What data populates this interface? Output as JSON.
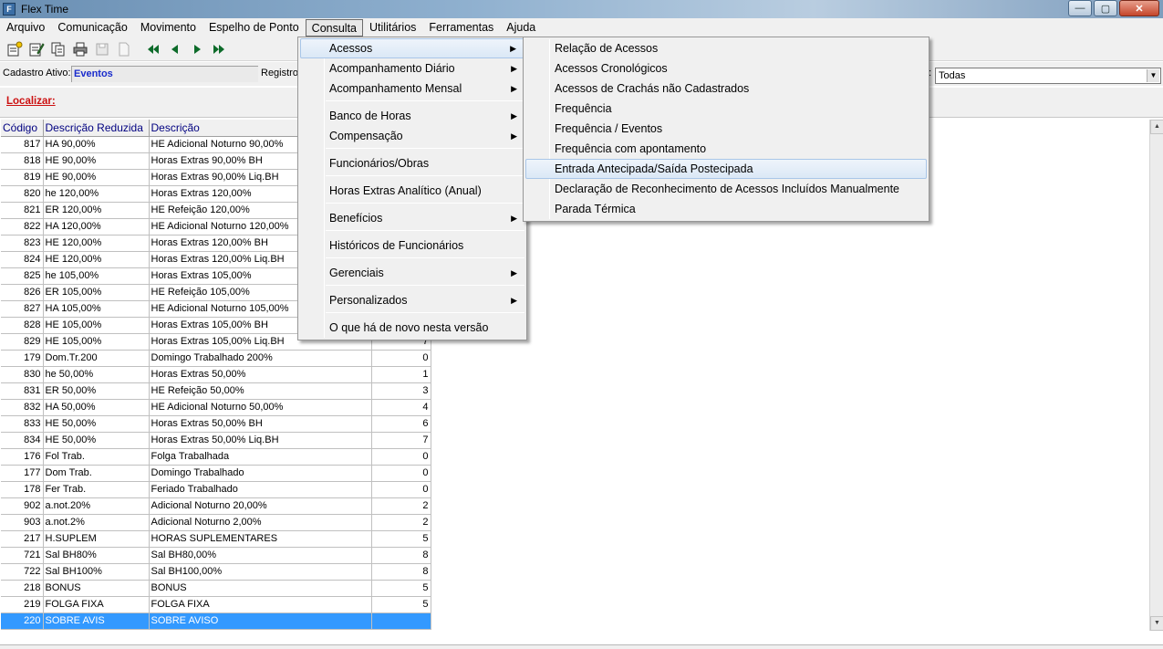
{
  "window": {
    "title": "Flex Time",
    "icon_letter": "F",
    "btn_minimize": "—",
    "btn_maximize": "▢",
    "btn_close": "✕"
  },
  "menubar": [
    "Arquivo",
    "Comunicação",
    "Movimento",
    "Espelho de Ponto",
    "Consulta",
    "Utilitários",
    "Ferramentas",
    "Ajuda"
  ],
  "toolbar": {
    "icons": [
      "new-record-icon",
      "edit-record-icon",
      "copy-record-icon",
      "print-icon",
      "save-icon",
      "blank-page-icon",
      "first-record-icon",
      "previous-record-icon",
      "next-record-icon",
      "last-record-icon"
    ]
  },
  "info": {
    "active_label": "Cadastro Ativo:",
    "active_value": "Eventos",
    "registro_label": "Registro",
    "filter_label_fragment": "a:",
    "filter_value": "Todas"
  },
  "find": {
    "label": "Localizar:"
  },
  "table": {
    "columns": [
      "Código",
      "Descrição Reduzida",
      "Descrição",
      ""
    ],
    "rows": [
      [
        "817",
        "HA 90,00%",
        "HE Adicional Noturno 90,00%",
        ""
      ],
      [
        "818",
        "HE 90,00%",
        "Horas Extras 90,00% BH",
        ""
      ],
      [
        "819",
        "HE 90,00%",
        "Horas Extras 90,00% Liq.BH",
        ""
      ],
      [
        "820",
        "he 120,00%",
        "Horas Extras 120,00%",
        ""
      ],
      [
        "821",
        "ER 120,00%",
        "HE Refeição 120,00%",
        ""
      ],
      [
        "822",
        "HA 120,00%",
        "HE Adicional Noturno 120,00%",
        ""
      ],
      [
        "823",
        "HE 120,00%",
        "Horas Extras 120,00% BH",
        ""
      ],
      [
        "824",
        "HE 120,00%",
        "Horas Extras 120,00% Liq.BH",
        ""
      ],
      [
        "825",
        "he 105,00%",
        "Horas Extras 105,00%",
        ""
      ],
      [
        "826",
        "ER 105,00%",
        "HE Refeição 105,00%",
        ""
      ],
      [
        "827",
        "HA 105,00%",
        "HE Adicional Noturno 105,00%",
        ""
      ],
      [
        "828",
        "HE 105,00%",
        "Horas Extras 105,00% BH",
        ""
      ],
      [
        "829",
        "HE 105,00%",
        "Horas Extras 105,00% Liq.BH",
        "7"
      ],
      [
        "179",
        "Dom.Tr.200",
        "Domingo Trabalhado 200%",
        "0"
      ],
      [
        "830",
        "he 50,00%",
        "Horas Extras 50,00%",
        "1"
      ],
      [
        "831",
        "ER 50,00%",
        "HE Refeição 50,00%",
        "3"
      ],
      [
        "832",
        "HA 50,00%",
        "HE Adicional Noturno 50,00%",
        "4"
      ],
      [
        "833",
        "HE 50,00%",
        "Horas Extras 50,00% BH",
        "6"
      ],
      [
        "834",
        "HE 50,00%",
        "Horas Extras 50,00% Liq.BH",
        "7"
      ],
      [
        "176",
        "Fol Trab.",
        "Folga Trabalhada",
        "0"
      ],
      [
        "177",
        "Dom Trab.",
        "Domingo Trabalhado",
        "0"
      ],
      [
        "178",
        "Fer Trab.",
        "Feriado Trabalhado",
        "0"
      ],
      [
        "902",
        "a.not.20%",
        "Adicional Noturno 20,00%",
        "2"
      ],
      [
        "903",
        "a.not.2%",
        "Adicional Noturno 2,00%",
        "2"
      ],
      [
        "217",
        "H.SUPLEM",
        "HORAS SUPLEMENTARES",
        "5"
      ],
      [
        "721",
        "Sal BH80%",
        "Sal BH80,00%",
        "8"
      ],
      [
        "722",
        "Sal BH100%",
        "Sal BH100,00%",
        "8"
      ],
      [
        "218",
        "BONUS",
        "BONUS",
        "5"
      ],
      [
        "219",
        "FOLGA FIXA",
        "FOLGA FIXA",
        "5"
      ],
      [
        "220",
        "SOBRE AVIS",
        "SOBRE AVISO",
        ""
      ]
    ],
    "selected_row": 29
  },
  "consulta_menu": {
    "items": [
      {
        "label": "Acessos",
        "submenu": true,
        "highlighted": true
      },
      {
        "label": "Acompanhamento Diário",
        "submenu": true
      },
      {
        "label": "Acompanhamento Mensal",
        "submenu": true
      },
      {
        "label": "Banco de Horas",
        "submenu": true
      },
      {
        "label": "Compensação",
        "submenu": true
      },
      {
        "label": "Funcionários/Obras",
        "submenu": false
      },
      {
        "label": "Horas Extras Analítico (Anual)",
        "submenu": false
      },
      {
        "label": "Benefícios",
        "submenu": true
      },
      {
        "label": "Históricos de Funcionários",
        "submenu": false
      },
      {
        "label": "Gerenciais",
        "submenu": true
      },
      {
        "label": "Personalizados",
        "submenu": true
      },
      {
        "label": "O que há de novo nesta versão",
        "submenu": false
      }
    ]
  },
  "acessos_menu": {
    "items": [
      "Relação de Acessos",
      "Acessos Cronológicos",
      "Acessos de Crachás não Cadastrados",
      "Frequência",
      "Frequência / Eventos",
      "Frequência com apontamento",
      "Entrada Antecipada/Saída Postecipada",
      "Declaração de Reconhecimento de Acessos Incluídos Manualmente",
      "Parada Térmica"
    ],
    "highlighted_index": 6
  },
  "colors": {
    "selection": "#3399ff",
    "menu_hover": "#dbe8f6",
    "header_text": "#000080",
    "find_label": "#cc1111",
    "active_value": "#1a2ccc"
  }
}
